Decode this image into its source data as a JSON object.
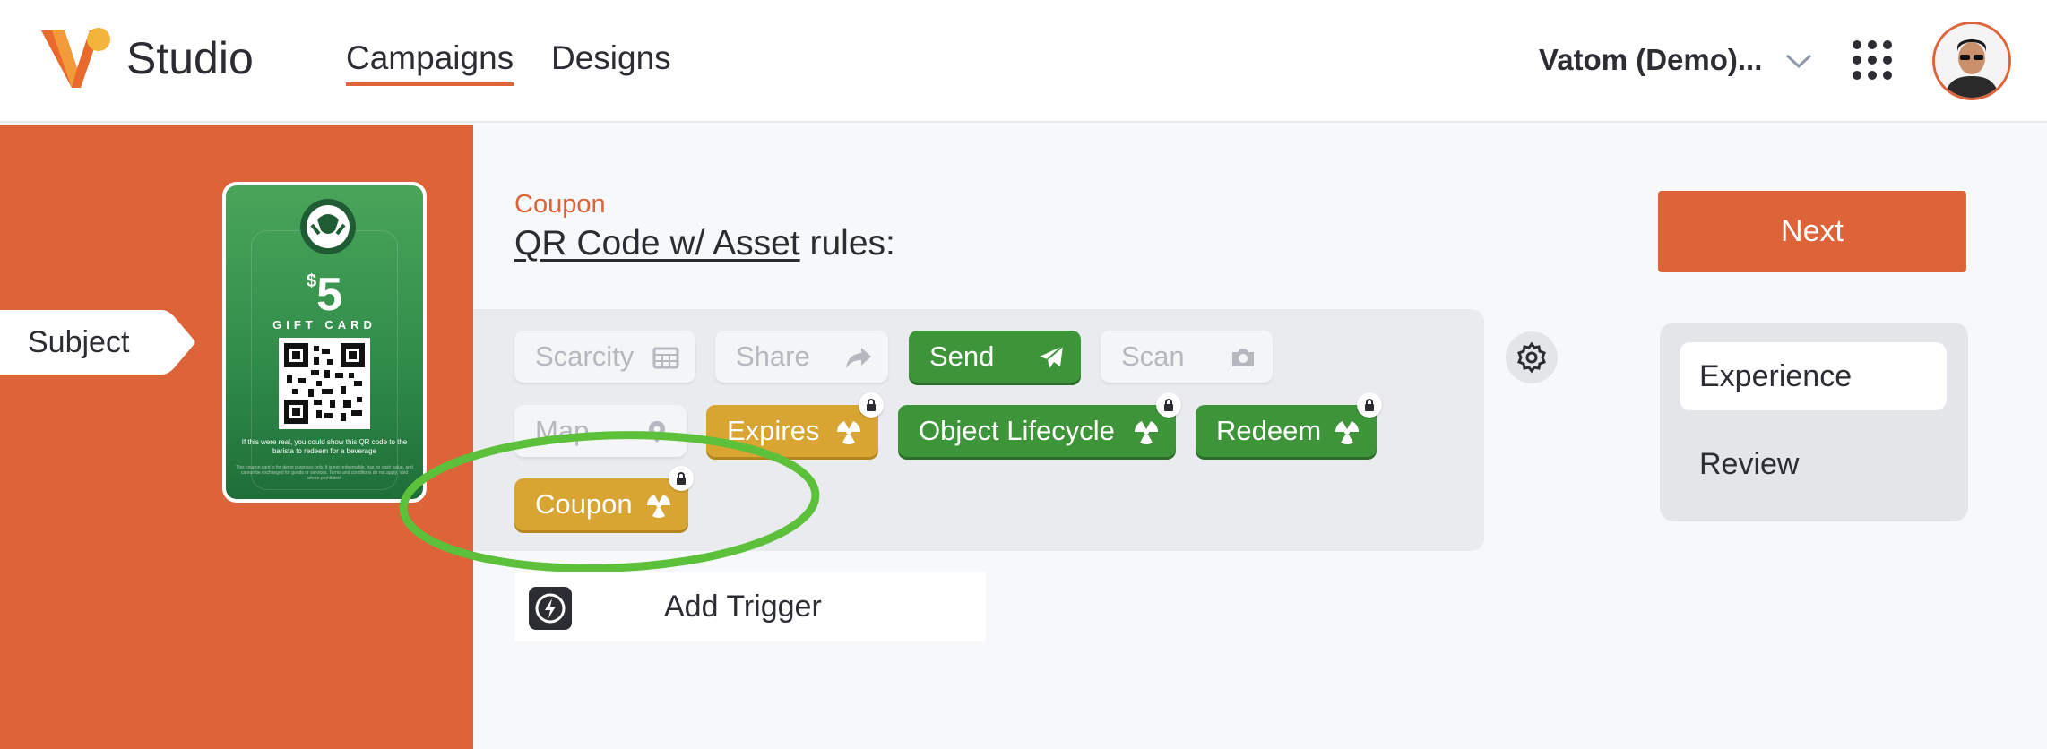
{
  "header": {
    "brand": "Studio",
    "nav": [
      "Campaigns",
      "Designs"
    ],
    "org_name": "Vatom (Demo)..."
  },
  "card": {
    "currency": "$",
    "amount": "5",
    "label": "GIFT CARD",
    "note": "If this were real, you could show this QR code to the barista to redeem for a beverage",
    "fine_print": "This coupon card is for demo purposes only. It is not redeemable, has no cash value, and cannot be exchanged for goods or services. Terms and conditions do not apply. Void where prohibited."
  },
  "subject_label": "Subject",
  "main": {
    "kicker": "Coupon",
    "title_link": "QR Code w/ Asset",
    "title_rest": " rules:"
  },
  "chips": {
    "scarcity": "Scarcity",
    "share": "Share",
    "send": "Send",
    "scan": "Scan",
    "map": "Map",
    "expires": "Expires",
    "object_lifecycle": "Object Lifecycle",
    "redeem": "Redeem",
    "coupon": "Coupon"
  },
  "add_trigger_label": "Add Trigger",
  "next_label": "Next",
  "steps": [
    "Experience",
    "Review"
  ],
  "colors": {
    "accent": "#dd6339",
    "green_chip": "#3e9438",
    "gold_chip": "#d9a532",
    "annotation": "#5cc03a"
  }
}
